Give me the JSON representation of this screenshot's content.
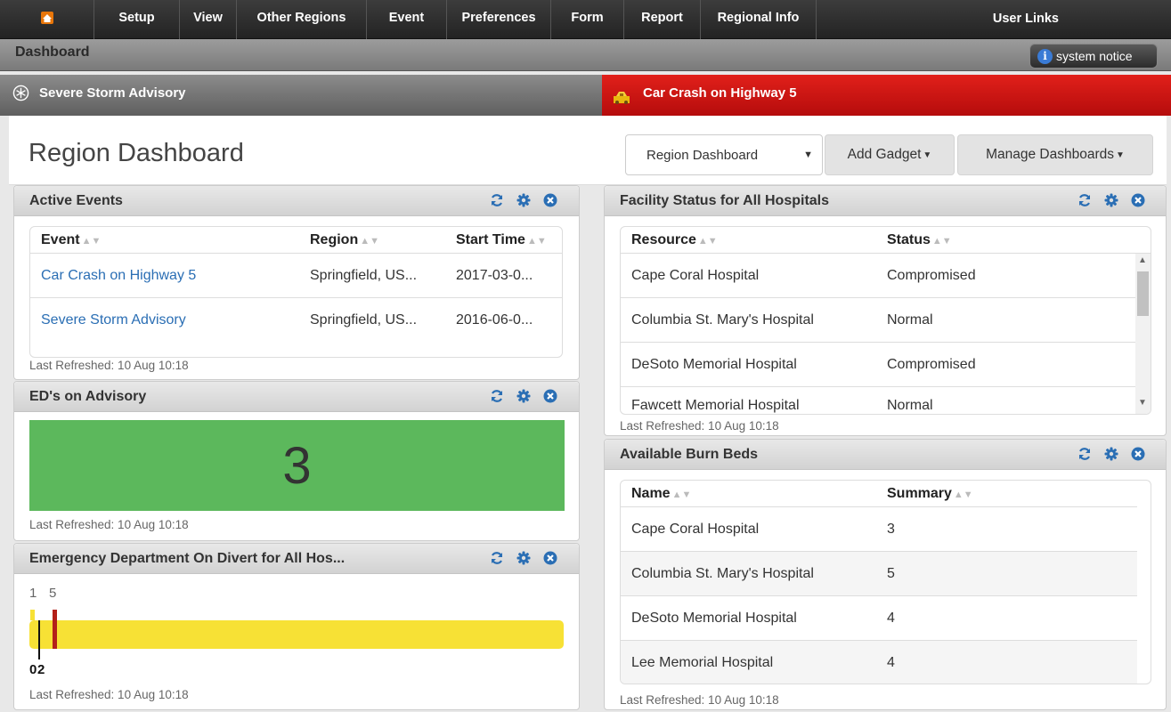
{
  "nav": {
    "items": [
      {
        "label": "Setup"
      },
      {
        "label": "View"
      },
      {
        "label": "Other Regions"
      },
      {
        "label": "Event"
      },
      {
        "label": "Preferences"
      },
      {
        "label": "Form"
      },
      {
        "label": "Report"
      },
      {
        "label": "Regional Info"
      },
      {
        "label": "User Links"
      }
    ]
  },
  "dashbar": {
    "title": "Dashboard",
    "system_notice": "system notice"
  },
  "alerts": {
    "left": "Severe Storm Advisory",
    "right": "Car Crash on Highway 5"
  },
  "header": {
    "title": "Region Dashboard",
    "select_value": "Region Dashboard",
    "add_gadget": "Add Gadget",
    "manage_dashboards": "Manage Dashboards"
  },
  "active_events": {
    "title": "Active Events",
    "columns": [
      "Event",
      "Region",
      "Start Time"
    ],
    "rows": [
      {
        "event": "Car Crash on Highway 5",
        "region": "Springfield, US...",
        "start": "2017-03-0..."
      },
      {
        "event": "Severe Storm Advisory",
        "region": "Springfield, US...",
        "start": "2016-06-0..."
      }
    ],
    "refreshed": "Last Refreshed: 10 Aug 10:18"
  },
  "eds_advisory": {
    "title": "ED's on Advisory",
    "count": "3",
    "refreshed": "Last Refreshed: 10 Aug 10:18"
  },
  "ed_divert": {
    "title": "Emergency Department On Divert for All Hos...",
    "marker_labels_top": [
      "1",
      "5"
    ],
    "marker_labels_bottom": [
      "0",
      "2"
    ],
    "refreshed": "Last Refreshed: 10 Aug 10:18",
    "colors": {
      "bar": "#f7e135",
      "red_marker": "#b3201a",
      "black_marker": "#111111"
    }
  },
  "facility_status": {
    "title": "Facility Status for All Hospitals",
    "columns": [
      "Resource",
      "Status"
    ],
    "rows": [
      {
        "resource": "Cape Coral Hospital",
        "status": "Compromised"
      },
      {
        "resource": "Columbia St. Mary's Hospital",
        "status": "Normal"
      },
      {
        "resource": "DeSoto Memorial Hospital",
        "status": "Compromised"
      },
      {
        "resource": "Fawcett Memorial Hospital",
        "status": "Normal"
      }
    ],
    "refreshed": "Last Refreshed: 10 Aug 10:18"
  },
  "burn_beds": {
    "title": "Available Burn Beds",
    "columns": [
      "Name",
      "Summary"
    ],
    "rows": [
      {
        "name": "Cape Coral Hospital",
        "summary": "3"
      },
      {
        "name": "Columbia St. Mary's Hospital",
        "summary": "5"
      },
      {
        "name": "DeSoto Memorial Hospital",
        "summary": "4"
      },
      {
        "name": "Lee Memorial Hospital",
        "summary": "4"
      }
    ],
    "refreshed": "Last Refreshed: 10 Aug 10:18"
  },
  "icons": [
    "home-icon",
    "info-icon",
    "snowflake-icon",
    "crash-icon",
    "refresh-icon",
    "gear-icon",
    "close-icon",
    "sort-icon",
    "caret-down-icon"
  ],
  "colors": {
    "alert_red": "#d0170f",
    "link": "#2a6eb4",
    "counter_green": "#5cb85c"
  }
}
